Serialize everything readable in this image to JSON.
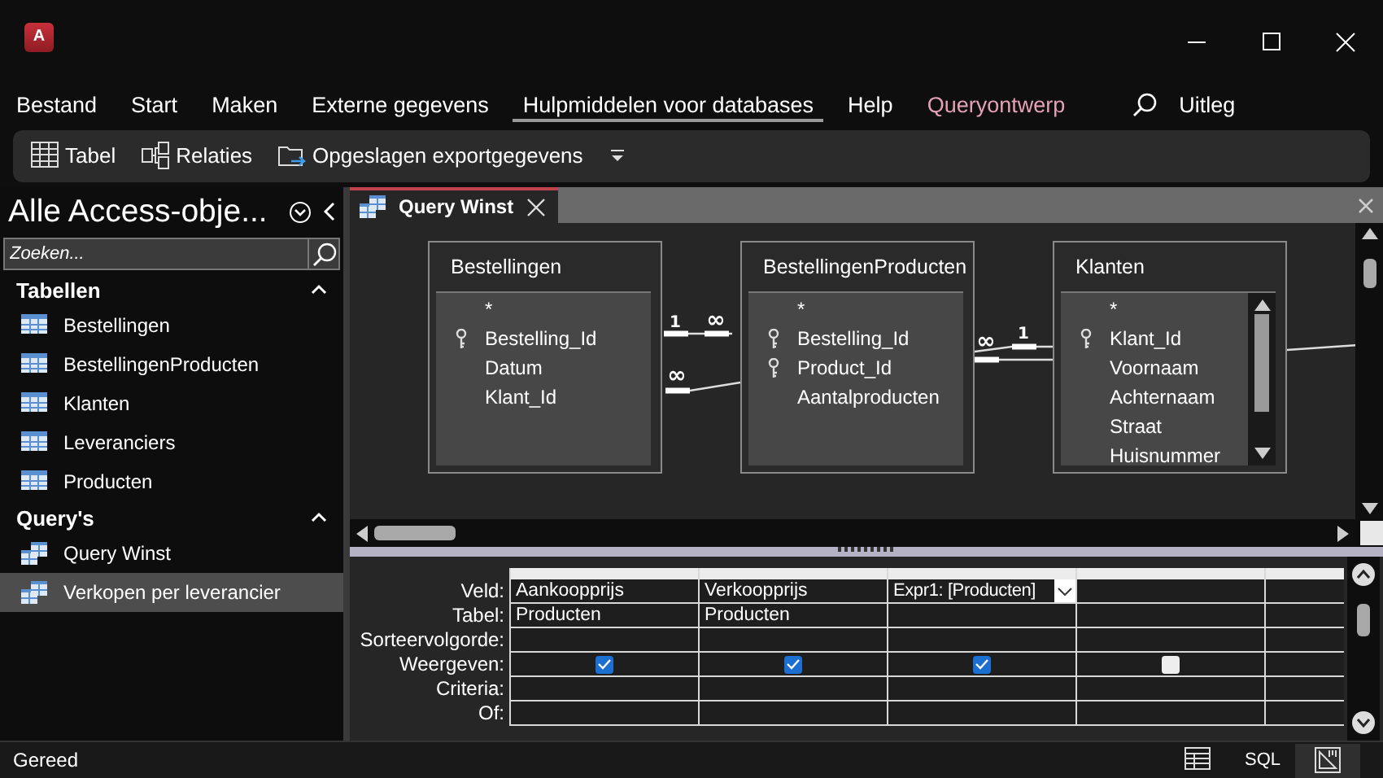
{
  "window": {
    "app_logo": "A"
  },
  "ribbon_tabs": [
    {
      "label": "Bestand",
      "selected": false,
      "kind": "normal"
    },
    {
      "label": "Start",
      "selected": false,
      "kind": "normal"
    },
    {
      "label": "Maken",
      "selected": false,
      "kind": "normal"
    },
    {
      "label": "Externe gegevens",
      "selected": false,
      "kind": "normal"
    },
    {
      "label": "Hulpmiddelen voor databases",
      "selected": true,
      "kind": "normal"
    },
    {
      "label": "Help",
      "selected": false,
      "kind": "normal"
    },
    {
      "label": "Queryontwerp",
      "selected": false,
      "kind": "contextual"
    }
  ],
  "tell_me": {
    "label": "Uitleg"
  },
  "toolbar": [
    {
      "label": "Tabel",
      "kind": "table"
    },
    {
      "label": "Relaties",
      "kind": "relations"
    },
    {
      "label": "Opgeslagen exportgegevens",
      "kind": "export"
    }
  ],
  "navigation": {
    "title": "Alle Access-obje...",
    "search": {
      "placeholder": "Zoeken..."
    },
    "groups": [
      {
        "label": "Tabellen",
        "kind": "table",
        "expanded": true,
        "items": [
          {
            "label": "Bestellingen",
            "selected": false
          },
          {
            "label": "BestellingenProducten",
            "selected": false
          },
          {
            "label": "Klanten",
            "selected": false
          },
          {
            "label": "Leveranciers",
            "selected": false
          },
          {
            "label": "Producten",
            "selected": false
          }
        ]
      },
      {
        "label": "Query's",
        "kind": "query",
        "expanded": true,
        "items": [
          {
            "label": "Query Winst",
            "selected": false
          },
          {
            "label": "Verkopen per leverancier",
            "selected": true
          }
        ]
      }
    ]
  },
  "document_tabs": [
    {
      "label": "Query Winst",
      "selected": true
    }
  ],
  "diagram": {
    "tables": [
      {
        "name": "Bestellingen",
        "scrollable": false,
        "fields": [
          {
            "name": "*",
            "key": false
          },
          {
            "name": "Bestelling_Id",
            "key": true
          },
          {
            "name": "Datum",
            "key": false
          },
          {
            "name": "Klant_Id",
            "key": false
          }
        ]
      },
      {
        "name": "BestellingenProducten",
        "scrollable": false,
        "fields": [
          {
            "name": "*",
            "key": false
          },
          {
            "name": "Bestelling_Id",
            "key": true
          },
          {
            "name": "Product_Id",
            "key": true
          },
          {
            "name": "Aantalproducten",
            "key": false
          }
        ]
      },
      {
        "name": "Klanten",
        "scrollable": true,
        "fields": [
          {
            "name": "*",
            "key": false
          },
          {
            "name": "Klant_Id",
            "key": true
          },
          {
            "name": "Voornaam",
            "key": false
          },
          {
            "name": "Achternaam",
            "key": false
          },
          {
            "name": "Straat",
            "key": false
          },
          {
            "name": "Huisnummer",
            "key": false
          }
        ]
      }
    ],
    "joins": [
      {
        "from_label": "1",
        "to_label": "∞"
      },
      {
        "from_label": "∞",
        "to_label": "1"
      },
      {
        "from_label": "∞"
      }
    ]
  },
  "design_grid": {
    "row_labels": [
      "Veld:",
      "Tabel:",
      "Sorteervolgorde:",
      "Weergeven:",
      "Criteria:",
      "Of:"
    ],
    "columns": [
      {
        "field": "Aankoopprijs",
        "table": "Producten",
        "show": true,
        "dropdown": false
      },
      {
        "field": "Verkoopprijs",
        "table": "Producten",
        "show": true,
        "dropdown": false
      },
      {
        "field": "Expr1: [Producten]",
        "show": true,
        "dropdown": true
      },
      {
        "show": false,
        "dropdown": false
      }
    ]
  },
  "status_bar": {
    "text": "Gereed",
    "views": [
      {
        "kind": "datasheet",
        "selected": false
      },
      {
        "kind": "sql",
        "label": "SQL",
        "selected": false
      },
      {
        "kind": "design",
        "selected": true
      }
    ]
  }
}
